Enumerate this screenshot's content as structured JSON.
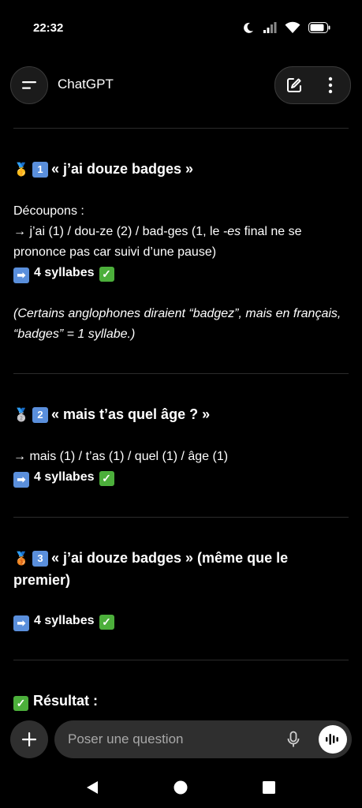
{
  "status": {
    "time": "22:32"
  },
  "header": {
    "title": "ChatGPT"
  },
  "sections": [
    {
      "medal": "🥇",
      "number": "1",
      "title": "« j’ai douze badges »",
      "intro": "Découpons :",
      "breakdown_pre": "→ j’ai (1) / dou-ze (2) / bad-ges (1, le ",
      "breakdown_em": "-es",
      "breakdown_post": " final ne se prononce pas car suivi d’une pause)",
      "result": "4 syllabes",
      "note": "(Certains anglophones diraient “badgez”, mais en français, “badges” = 1 syllabe.)"
    },
    {
      "medal": "🥈",
      "number": "2",
      "title": "« mais t’as quel âge ? »",
      "breakdown": "→ mais (1) / t’as (1) / quel (1) / âge (1)",
      "result": "4 syllabes"
    },
    {
      "medal": "🥉",
      "number": "3",
      "title": "« j’ai douze badges » (même que le premier)",
      "result": "4 syllabes"
    }
  ],
  "summary": {
    "title": "Résultat :"
  },
  "composer": {
    "placeholder": "Poser une question"
  },
  "icons": {
    "arrow": "➡",
    "check": "✓",
    "plus": "+"
  }
}
